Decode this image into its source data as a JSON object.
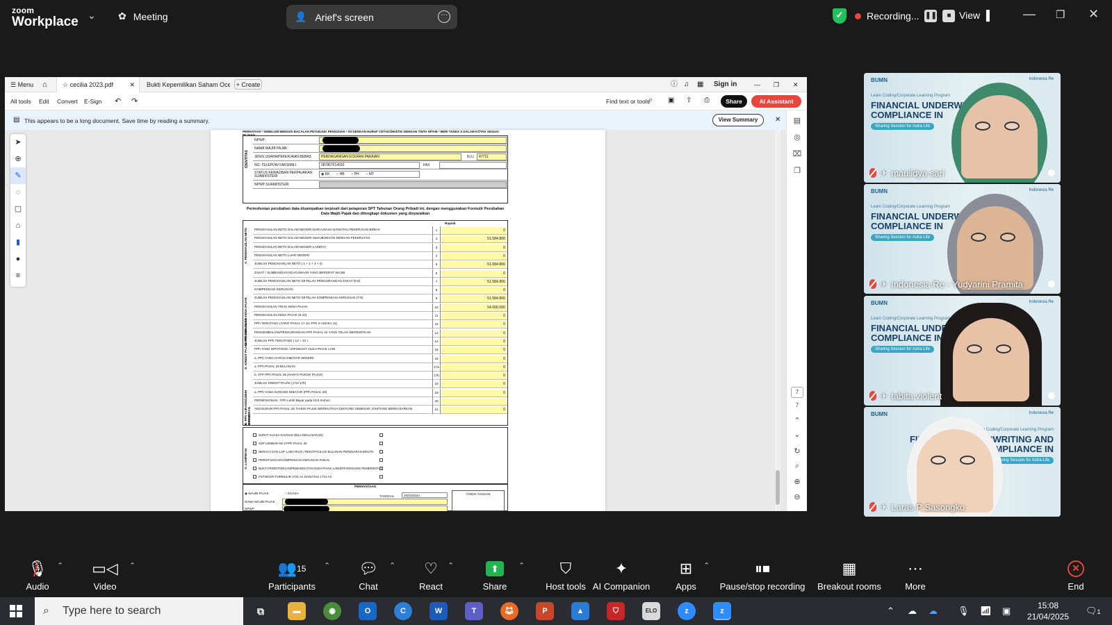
{
  "zoom": {
    "logo_line1": "zoom",
    "logo_line2": "Workplace",
    "meeting_label": "Meeting",
    "screen_share_label": "Arief's screen",
    "recording_label": "Recording...",
    "view_label": "View"
  },
  "pdf": {
    "tabs": [
      "cecilia 2023.pdf",
      "Bukti Kepemilikan Saham Ocea..",
      "Create"
    ],
    "menu_label": "Menu",
    "sign_in": "Sign in",
    "tools": [
      "All tools",
      "Edit",
      "Convert",
      "E-Sign"
    ],
    "find_label": "Find text or tools",
    "share_label": "Share",
    "ai_label": "AI Assistant",
    "summary_text": "This appears to be a long document. Save time by reading a summary.",
    "summary_button": "View Summary",
    "page_current": "7",
    "page_total": "7"
  },
  "form": {
    "header": "PERHATIAN  * SEBELUM MENGISI BACALAH PETUNJUK PENGISIAN  * ISI DENGAN HURUF CETAK/DIKETIK DENGAN TINTA HITAM  * BERI TANDA X DALAM KOTAK SESUAI PILIHAN",
    "identity_side": "IDENTITAS",
    "npwp_label": "NPWP",
    "nama_label": "NAMA WAJIB PAJAK",
    "jenis_label": "JENIS USAHA/PEKERJAAN BEBAS",
    "jenis_value": "PERDAGANGAN ECERAN PAKAIAN",
    "klu_label": "KLU",
    "klu_value": "47711",
    "telp_label": "NO. TELEPON/ FAKSIMILI",
    "telp_value": "087867614030",
    "fax_label": "FAX",
    "status_label": "STATUS KEWAJIBAN PERPAJAKAN SUAMI/ISTERI",
    "status_options": [
      "KK",
      "HB",
      "PH",
      "MT"
    ],
    "npwp_suami_label": "NPWP SUAMI/ISTERI",
    "notice": "Permohonan perubahan data disampaikan terpisah dari pelaporan SPT Tahunan Orang Pribadi ini, dengan menggunakan Formulir Perubahan Data Wajib Pajak dan dilengkapi dokumen yang disyaratkan",
    "rupiah_label": "Rupiah",
    "calc_rows": [
      {
        "n": "1",
        "label": "PENGHASILAN NETO DALAM NEGERI DARI USAHA DAN/ATAU PEKERJAAN BEBAS",
        "v": "0"
      },
      {
        "n": "2",
        "label": "PENGHASILAN NETO DALAM NEGERI SEHUBUNGAN DENGAN PEKERJAAN",
        "v": "51.584.806"
      },
      {
        "n": "3",
        "label": "PENGHASILAN NETO DALAM NEGERI LAINNYA",
        "v": "0"
      },
      {
        "n": "4",
        "label": "PENGHASILAN NETO LUAR NEGERI",
        "v": "0"
      },
      {
        "n": "5",
        "label": "JUMLAH PENGHASILAN NETO ( 1 + 2 + 3 + 4)",
        "v": "51.584.806"
      },
      {
        "n": "6",
        "label": "ZAKAT / SUMBANGAN KEAGAMAAN YANG BERSIFAT WAJIB",
        "v": "0"
      },
      {
        "n": "7",
        "label": "JUMLAH PENGHASILAN NETO SETELAH PENGURANGAN ZAKAT (5-6)",
        "v": "51.584.806"
      },
      {
        "n": "8",
        "label": "KOMPENSASI KERUGIAN",
        "v": "0"
      },
      {
        "n": "9",
        "label": "JUMLAH PENGHASILAN NETO SETELAH KOMPENSASI KERUGIAN (7-8)",
        "v": "51.584.806"
      },
      {
        "n": "10",
        "label": "PENGHASILAN TIDAK KENA PAJAK",
        "v": "54.000.000"
      },
      {
        "n": "11",
        "label": "PENGHASILAN KENA PAJAK (9-10)",
        "v": "0"
      },
      {
        "n": "12",
        "label": "PPh TERUTANG (TARIF PASAL 17 UU PPh X ANGKA 11)",
        "v": "0"
      },
      {
        "n": "13",
        "label": "PENGEMBALIAN/PENGURANGAN PPh PASAL 24 YANG TELAH DIKREDITKAN",
        "v": "0"
      },
      {
        "n": "14",
        "label": "JUMLAH PPh TERUTANG ( 12 + 13 )",
        "v": "0"
      },
      {
        "n": "15",
        "label": "PPh YANG DIPOTONG / DIPUNGUT OLEH PIHAK LAIN",
        "v": "0"
      },
      {
        "n": "16",
        "label": "a. PPh YANG HARUS DIBAYAR SENDIRI",
        "v": "0"
      },
      {
        "n": "17a",
        "label": "a. PPh PASAL 25 BULANAN",
        "v": "0"
      },
      {
        "n": "17b",
        "label": "b. STP PPh PASAL 25 (HANYA POKOK PAJAK)",
        "v": "0"
      },
      {
        "n": "18",
        "label": "JUMLAH KREDIT PAJAK (17a+17b)",
        "v": "0"
      },
      {
        "n": "19",
        "label": "a. PPh YANG KURANG DIBAYAR (PPh PASAL 29)",
        "v": "0"
      },
      {
        "n": "20",
        "label": "PERMOHONAN : PPh Lebih Bayar pada 19.b mohon",
        "v": ""
      },
      {
        "n": "21",
        "label": "ANGSURAN PPh PASAL 25 TAHUN PAJAK BERIKUTNYA DIHITUNG SEBESAR, DIHITUNG BERDASARKAN",
        "v": "0"
      }
    ],
    "calc_sides": [
      "A. PENGHASILAN NETO",
      "B. PENGHASILAN KENA PAJAK",
      "C. PPh TERUTANG",
      "D. KREDIT PAJAK",
      "E. PPh KURANG/LEBIH BAYAR",
      "F. ANGSURAN"
    ],
    "attach_side": "G. LAMPIRAN",
    "attach_rows": [
      "SURAT KUASA KHUSUS (BILA DIKUASAKAN)",
      "SSP LEMBAR KE-3 PPh PASAL 29",
      "NERACA DAN LAP. LABA RUGI / REKAPITULASI BULANAN PEREDARAN BRUTO",
      "PERHITUNGAN KOMPENSASI KERUGIAN FISKAL",
      "BUKTI PEMOTONGAN/PEMUNGUTAN OLEH PIHAK LAIN/DITANGGUNG PEMERINTAH",
      "FOTOKOPI FORMULIR 1721-A1 DAN/ATAU 1721-A2"
    ],
    "sign_title": "PERNYATAAN",
    "sign_wp": "WAJIB PAJAK",
    "sign_kuasa": "KUASA",
    "sign_date_label": "TANGGAL",
    "sign_date": "20/03/2024",
    "sign_ttd": "TANDA TANGAN",
    "sign_nama": "NAMA WAJIB PAJAK",
    "sign_npwp": "NPWP"
  },
  "participants": [
    {
      "name": "maulidya sari"
    },
    {
      "name": "Indonesia Re - Yudyarini Pramita"
    },
    {
      "name": "tabita.violent"
    },
    {
      "name": "Laras P Sasongko"
    }
  ],
  "slide": {
    "brand": "BUMN",
    "brand2": "Indonesia Re",
    "subtitle": "Learn Coding/Corporate Learning Program",
    "title": "FINANCIAL UNDERWRITING AND COMPLIANCE IN",
    "pill": "Sharing Session for Astra Life"
  },
  "toolbar": {
    "audio": "Audio",
    "video": "Video",
    "participants": "Participants",
    "participants_count": "15",
    "chat": "Chat",
    "react": "React",
    "share": "Share",
    "host_tools": "Host tools",
    "ai_companion": "AI Companion",
    "apps": "Apps",
    "pause_recording": "Pause/stop recording",
    "breakout": "Breakout rooms",
    "more": "More",
    "end": "End"
  },
  "taskbar": {
    "search_placeholder": "Type here to search",
    "time": "15:08",
    "date": "21/04/2025",
    "notif_count": "1"
  }
}
